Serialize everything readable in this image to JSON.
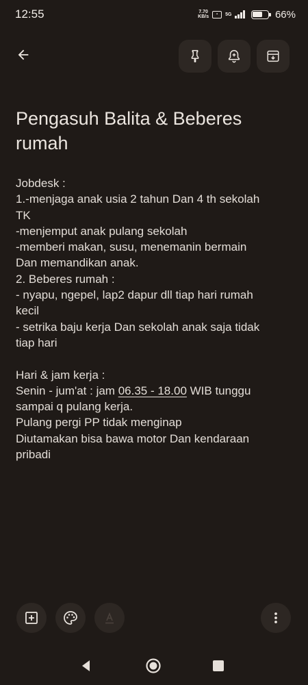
{
  "status_bar": {
    "time": "12:55",
    "net_speed_value": "7.70",
    "net_speed_unit": "KB/s",
    "network_type": "5G",
    "battery_percent": "66%",
    "battery_level": 0.66
  },
  "toolbar": {
    "icons": [
      "arrow-back-icon",
      "pin-icon",
      "reminder-bell-icon",
      "archive-icon"
    ]
  },
  "note": {
    "title_line1": "Pengasuh Balita & Beberes",
    "title_line2": "rumah",
    "lines": [
      "Jobdesk :",
      "1.-menjaga anak usia 2 tahun Dan 4 th sekolah",
      "TK",
      "-menjemput anak pulang sekolah",
      "-memberi makan, susu, menemanin bermain",
      "Dan memandikan anak.",
      "2. Beberes rumah :",
      "- nyapu, ngepel, lap2 dapur dll tiap hari rumah",
      "kecil",
      "- setrika baju kerja Dan sekolah anak saja tidak",
      "tiap hari",
      "",
      "Hari & jam kerja :"
    ],
    "schedule_prefix": "Senin - jum'at : jam ",
    "schedule_time": "06.35 - 18.00",
    "schedule_suffix": " WIB tunggu",
    "lines_after": [
      "sampai q pulang kerja.",
      "Pulang pergi PP tidak menginap",
      "Diutamakan bisa bawa motor Dan kendaraan",
      "pribadi"
    ]
  },
  "bottom_bar": {
    "icons": [
      "add-box-icon",
      "palette-icon",
      "text-format-icon",
      "more-vert-icon"
    ]
  },
  "colors": {
    "background": "#1f1a17",
    "button_bg": "#2d2723",
    "text": "#e8e2dc"
  }
}
